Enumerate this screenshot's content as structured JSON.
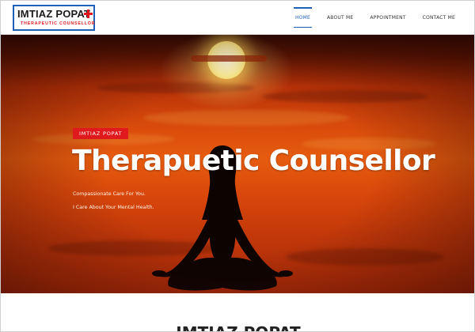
{
  "logo": {
    "name": "IMTIAZ POPAT",
    "subtitle": "THERAPEUTIC COUNSELLOR"
  },
  "nav": {
    "items": [
      {
        "label": "HOME",
        "active": true
      },
      {
        "label": "ABOUT ME",
        "active": false
      },
      {
        "label": "APPOINTMENT",
        "active": false
      },
      {
        "label": "CONTACT ME",
        "active": false
      }
    ]
  },
  "hero": {
    "tag": "IMTIAZ POPAT",
    "title": "Therapuetic Counsellor",
    "line1": "Compassionate Care For You.",
    "line2": "I Care About Your Mental Health."
  },
  "section": {
    "title": "IMTIAZ POPAT"
  },
  "colors": {
    "accent_blue": "#1f5fb8",
    "accent_red": "#e0191e",
    "hero_orange": "#e65c0e"
  },
  "icons": [
    "red-cross-icon"
  ]
}
